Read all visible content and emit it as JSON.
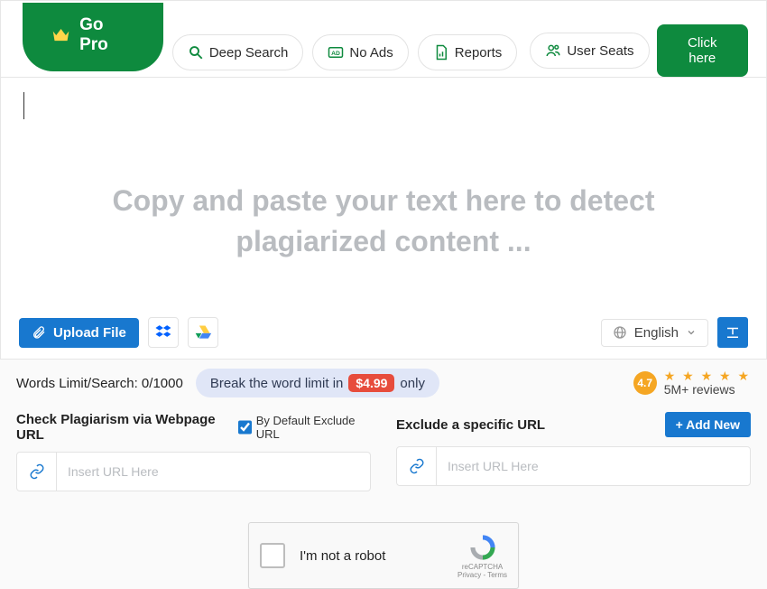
{
  "topbar": {
    "gopro": "Go Pro",
    "deep_search": "Deep Search",
    "no_ads": "No Ads",
    "reports": "Reports",
    "user_seats": "User Seats",
    "click_here": "Click here"
  },
  "editor": {
    "placeholder": "Copy and paste your text here to detect plagiarized content ...",
    "upload": "Upload File",
    "language": "English"
  },
  "status": {
    "words_limit_label": "Words Limit/Search: 0/1000",
    "break_prefix": "Break the word limit in",
    "price": "$4.99",
    "break_suffix": "only"
  },
  "rating": {
    "badge": "4.7",
    "stars": "★ ★ ★ ★ ★",
    "reviews": "5M+ reviews"
  },
  "url": {
    "check_title": "Check Plagiarism via Webpage URL",
    "default_exclude": "By Default Exclude URL",
    "exclude_title": "Exclude a specific URL",
    "add_new": "+ Add New",
    "placeholder": "Insert URL Here"
  },
  "captcha": {
    "text": "I'm not a robot",
    "brand": "reCAPTCHA",
    "terms": "Privacy - Terms"
  }
}
